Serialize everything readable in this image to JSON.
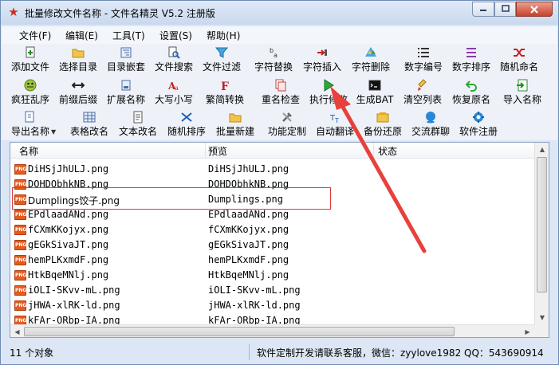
{
  "window": {
    "title": "批量修改文件名称 - 文件名精灵 V5.2 注册版",
    "controls": {
      "minimize": "minimize",
      "maximize": "maximize",
      "close": "close"
    }
  },
  "menu": [
    "文件(F)",
    "编辑(E)",
    "工具(T)",
    "设置(S)",
    "帮助(H)"
  ],
  "toolbar": {
    "row1": [
      {
        "label": "添加文件",
        "icon": "add-file-icon"
      },
      {
        "label": "选择目录",
        "icon": "folder-icon"
      },
      {
        "label": "目录嵌套",
        "icon": "nested-folder-icon"
      },
      {
        "label": "文件搜索",
        "icon": "file-search-icon"
      },
      {
        "label": "文件过滤",
        "icon": "filter-icon"
      },
      {
        "label": "字符替换",
        "icon": "replace-icon"
      },
      {
        "label": "字符插入",
        "icon": "insert-icon"
      },
      {
        "label": "字符删除",
        "icon": "delete-char-icon"
      },
      {
        "label": "数字编号",
        "icon": "number-list-icon"
      },
      {
        "label": "数字排序",
        "icon": "sort-icon"
      },
      {
        "label": "随机命名",
        "icon": "shuffle-icon"
      }
    ],
    "row2": [
      {
        "label": "疯狂乱序",
        "icon": "crazy-shuffle-icon"
      },
      {
        "label": "前缀后缀",
        "icon": "prefix-suffix-icon"
      },
      {
        "label": "扩展名称",
        "icon": "extension-icon"
      },
      {
        "label": "大写小写",
        "icon": "case-icon"
      },
      {
        "label": "繁简转换",
        "icon": "convert-icon"
      },
      {
        "label": "重名检查",
        "icon": "duplicate-check-icon"
      },
      {
        "label": "执行修改",
        "icon": "play-icon"
      },
      {
        "label": "生成BAT",
        "icon": "bat-icon"
      },
      {
        "label": "清空列表",
        "icon": "clear-list-icon"
      },
      {
        "label": "恢复原名",
        "icon": "undo-icon"
      },
      {
        "label": "导入名称",
        "icon": "import-icon"
      }
    ],
    "row3": [
      {
        "label": "导出名称",
        "icon": "export-icon"
      },
      {
        "label": "表格改名",
        "icon": "table-icon"
      },
      {
        "label": "文本改名",
        "icon": "text-icon"
      },
      {
        "label": "随机排序",
        "icon": "random-sort-icon"
      },
      {
        "label": "批量新建",
        "icon": "new-folder-icon"
      },
      {
        "label": "功能定制",
        "icon": "tools-icon"
      },
      {
        "label": "自动翻译",
        "icon": "translate-icon"
      },
      {
        "label": "备份还原",
        "icon": "backup-icon"
      },
      {
        "label": "交流群聊",
        "icon": "chat-icon"
      },
      {
        "label": "软件注册",
        "icon": "register-icon"
      }
    ]
  },
  "list": {
    "columns": [
      "名称",
      "预览",
      "状态"
    ],
    "file_badge": "PNG",
    "rows": [
      {
        "name": "DiHSjJhULJ.png",
        "preview": "DiHSjJhULJ.png",
        "status": ""
      },
      {
        "name": "DOHDObhkNB.png",
        "preview": "DOHDObhkNB.png",
        "status": ""
      },
      {
        "name": "Dumplings饺子.png",
        "preview": "Dumplings.png",
        "status": ""
      },
      {
        "name": "EPdlaadANd.png",
        "preview": "EPdlaadANd.png",
        "status": ""
      },
      {
        "name": "fCXmKKojyx.png",
        "preview": "fCXmKKojyx.png",
        "status": ""
      },
      {
        "name": "gEGkSivaJT.png",
        "preview": "gEGkSivaJT.png",
        "status": ""
      },
      {
        "name": "hemPLKxmdF.png",
        "preview": "hemPLKxmdF.png",
        "status": ""
      },
      {
        "name": "HtkBqeMNlj.png",
        "preview": "HtkBqeMNlj.png",
        "status": ""
      },
      {
        "name": "iOLI-SKvv-mL.png",
        "preview": "iOLI-SKvv-mL.png",
        "status": ""
      },
      {
        "name": "jHWA-xlRK-ld.png",
        "preview": "jHWA-xlRK-ld.png",
        "status": ""
      },
      {
        "name": "kFAr-ORbp-IA.png",
        "preview": "kFAr-ORbp-IA.png",
        "status": ""
      }
    ]
  },
  "status": {
    "count": "11 个对象",
    "contact": "软件定制开发请联系客服，微信：zyylove1982   QQ：543690914"
  },
  "colors": {
    "highlight": "#d9393a",
    "annotation_arrow": "#e8413b",
    "file_icon": "#e35b1f"
  }
}
